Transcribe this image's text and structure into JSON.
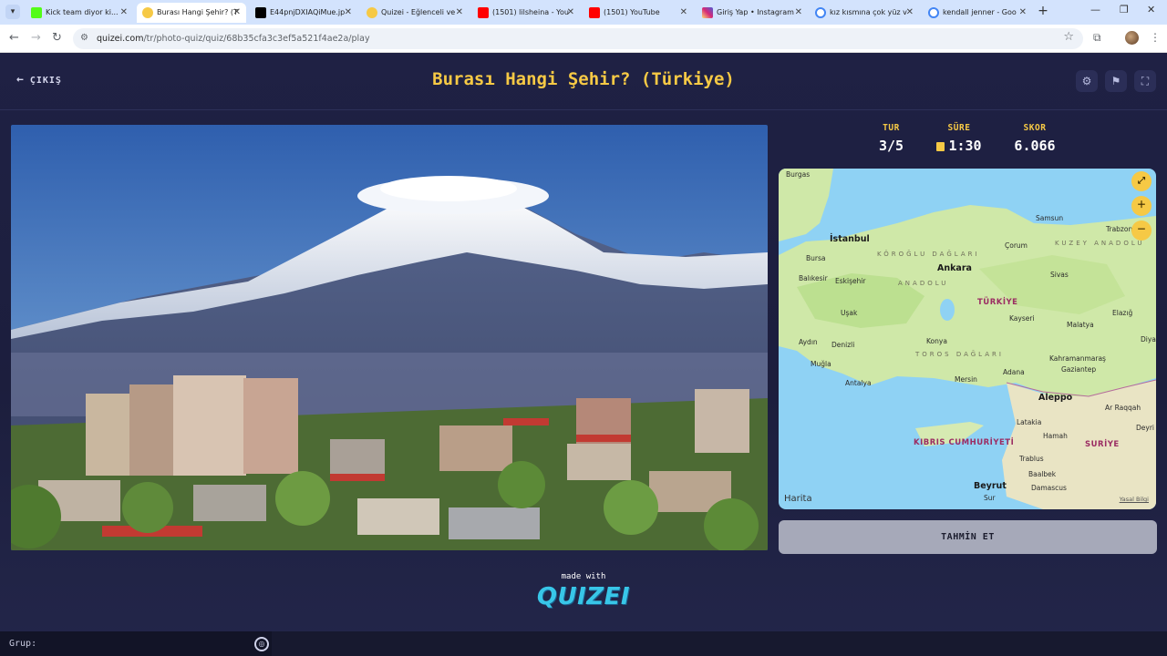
{
  "browser": {
    "tabs": [
      {
        "title": "Kick team diyor ki...",
        "active": false,
        "favicon_color": "#53fc18"
      },
      {
        "title": "Burası Hangi Şehir? (T",
        "active": true,
        "favicon_color": "#f6c945"
      },
      {
        "title": "E44pnjDXIAQiMue.jp",
        "active": false,
        "favicon_color": "#000000"
      },
      {
        "title": "Quizei - Eğlenceli ve",
        "active": false,
        "favicon_color": "#f6c945"
      },
      {
        "title": "(1501) lilsheina - You",
        "active": false,
        "favicon_color": "#ff0000"
      },
      {
        "title": "(1501) YouTube",
        "active": false,
        "favicon_color": "#ff0000"
      },
      {
        "title": "Giriş Yap • Instagram",
        "active": false,
        "favicon_color": "#d62976"
      },
      {
        "title": "kız kısmına çok yüz v",
        "active": false,
        "favicon_color": "#4285f4"
      },
      {
        "title": "kendall jenner - Goo",
        "active": false,
        "favicon_color": "#4285f4"
      }
    ],
    "url_host": "quizei.com",
    "url_path": "/tr/photo-quiz/quiz/68b35cfa3c3ef5a521f4ae2a/play"
  },
  "header": {
    "exit_label": "ÇIKIŞ",
    "title": "Burası Hangi Şehir? (Türkiye)",
    "icons": [
      "settings-icon",
      "flag-icon",
      "fullscreen-icon"
    ]
  },
  "stats": {
    "round_label": "TUR",
    "round_value": "3/5",
    "time_label": "SÜRE",
    "time_value": "1:30",
    "score_label": "SKOR",
    "score_value": "6.066"
  },
  "map": {
    "cities": [
      {
        "name": "Burgas"
      },
      {
        "name": "İstanbul"
      },
      {
        "name": "Samsun"
      },
      {
        "name": "Trabzon"
      },
      {
        "name": "Çorum"
      },
      {
        "name": "Bursa"
      },
      {
        "name": "Ankara"
      },
      {
        "name": "Balıkesir"
      },
      {
        "name": "Eskişehir"
      },
      {
        "name": "Sivas"
      },
      {
        "name": "Kayseri"
      },
      {
        "name": "Uşak"
      },
      {
        "name": "Malatya"
      },
      {
        "name": "Elazığ"
      },
      {
        "name": "Aydın"
      },
      {
        "name": "Denizli"
      },
      {
        "name": "Konya"
      },
      {
        "name": "Diya"
      },
      {
        "name": "Muğla"
      },
      {
        "name": "Kahramanmaraş"
      },
      {
        "name": "Gaziantep"
      },
      {
        "name": "Adana"
      },
      {
        "name": "Mersin"
      },
      {
        "name": "Antalya"
      },
      {
        "name": "Aleppo"
      },
      {
        "name": "Ar Raqqah"
      },
      {
        "name": "Latakia"
      },
      {
        "name": "Deyri"
      },
      {
        "name": "Hamah"
      },
      {
        "name": "Trablus"
      },
      {
        "name": "Baalbek"
      },
      {
        "name": "Beyrut"
      },
      {
        "name": "Damascus"
      },
      {
        "name": "Sur"
      }
    ],
    "countries": [
      "TÜRKİYE",
      "KIBRIS CUMHURİYETİ",
      "SURİYE"
    ],
    "ranges": [
      "KÖROĞLU DAĞLARI",
      "KUZEY ANADOLU",
      "ANADOLU",
      "TOROS DAĞLARI"
    ],
    "brand": "Harita",
    "legal": "Yasal Bilgi"
  },
  "guess_button": "TAHMİN ET",
  "footer": {
    "made_with": "made with",
    "logo": "QUIZEI"
  },
  "bottom": {
    "group_label": "Grup:"
  },
  "colors": {
    "accent": "#f6c945",
    "page_bg": "#1c1f3f",
    "logo": "#38c6e8"
  }
}
